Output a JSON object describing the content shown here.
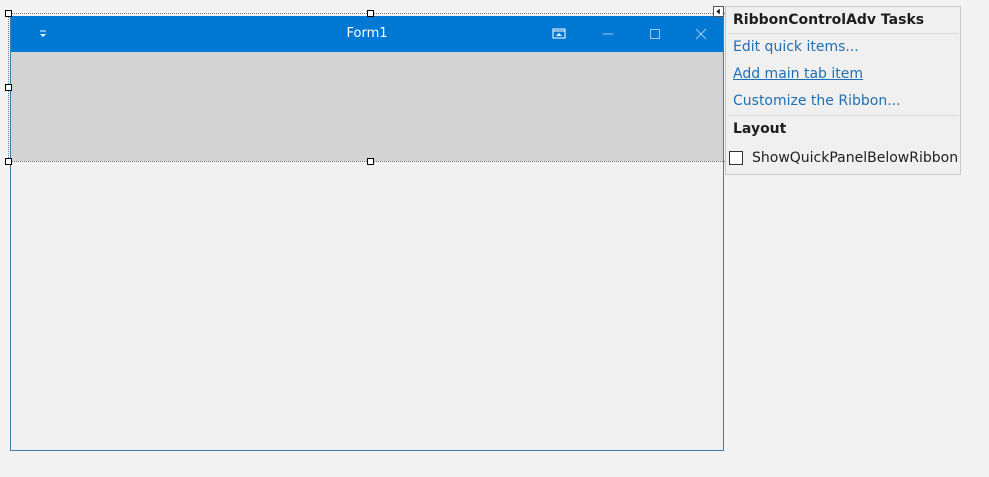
{
  "form": {
    "title": "Form1"
  },
  "title_bar": {
    "qat_icon": "chevron-down-icon",
    "buttons": [
      "restore-ribbon-icon",
      "minimize-icon",
      "maximize-icon",
      "close-icon"
    ]
  },
  "tasks": {
    "header": "RibbonControlAdv Tasks",
    "links": [
      "Edit quick items...",
      "Add main tab item",
      "Customize the Ribbon..."
    ],
    "section": "Layout",
    "checkbox_label": "ShowQuickPanelBelowRibbon",
    "checkbox_checked": false
  },
  "colors": {
    "title_bar": "#0078d4",
    "ribbon_area": "#d3d3d3",
    "link": "#1e6fb5"
  }
}
